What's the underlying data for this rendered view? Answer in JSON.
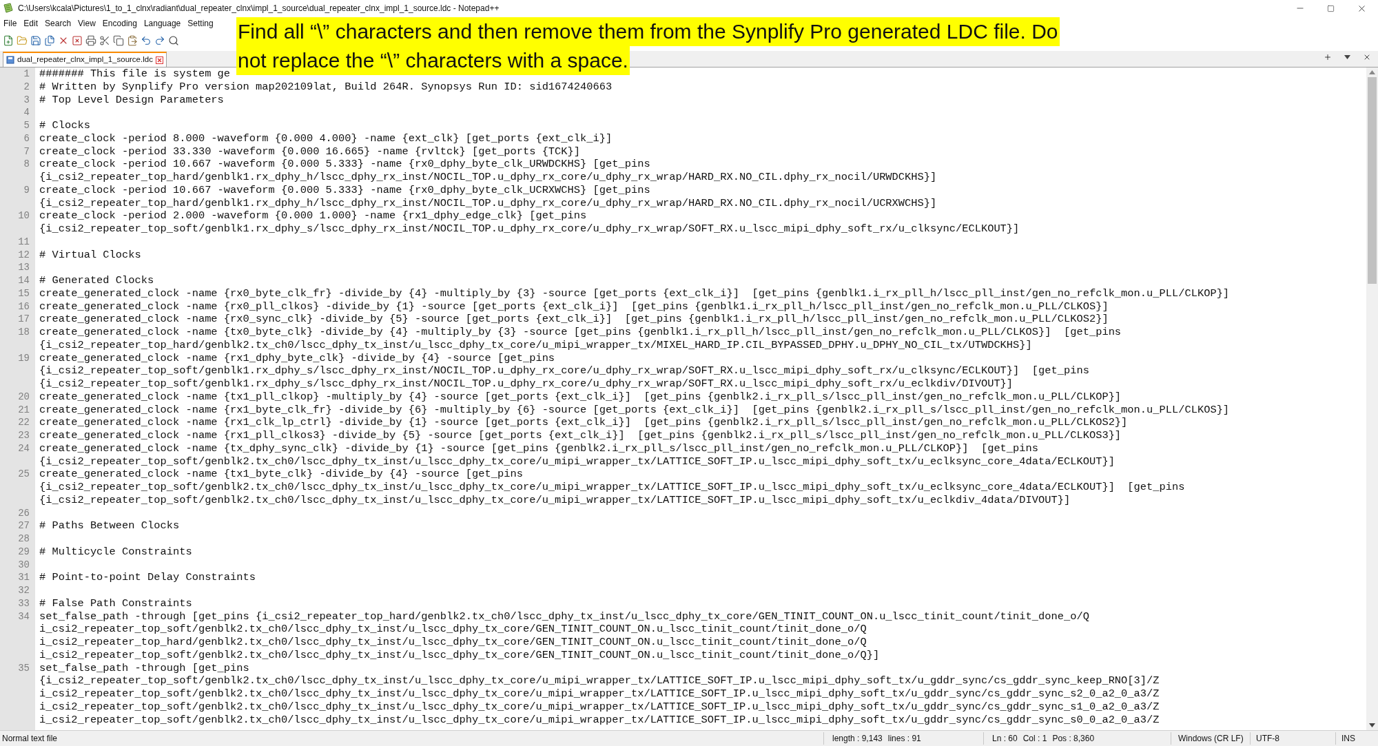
{
  "window": {
    "title": "C:\\Users\\kcala\\Pictures\\1_to_1_clnx\\radiant\\dual_repeater_clnx\\impl_1_source\\dual_repeater_clnx_impl_1_source.ldc - Notepad++"
  },
  "menu": [
    "File",
    "Edit",
    "Search",
    "View",
    "Encoding",
    "Language",
    "Setting"
  ],
  "tabs": [
    {
      "label": "dual_repeater_clnx_impl_1_source.ldc",
      "selected": true
    }
  ],
  "banner": {
    "lines": [
      "Find all “\\” characters and then remove them from the Synplify Pro generated LDC file. Do",
      "not replace the “\\” characters with a space."
    ]
  },
  "editor": {
    "lines": [
      {
        "number": "1",
        "segments": [
          "####### This file is system ge"
        ]
      },
      {
        "number": "2",
        "segments": [
          "# Written by Synplify Pro version map202109lat, Build 264R. Synopsys Run ID: sid1674240663"
        ]
      },
      {
        "number": "3",
        "segments": [
          "# Top Level Design Parameters"
        ]
      },
      {
        "number": "4"
      },
      {
        "number": "5",
        "segments": [
          "# Clocks"
        ]
      },
      {
        "number": "6",
        "segments": [
          "create_clock -period 8.000 -waveform {0.000 4.000} -name {ext_clk} [get_ports {ext_clk_i}]"
        ]
      },
      {
        "number": "7",
        "segments": [
          "create_clock -period 33.330 -waveform {0.000 16.665} -name {rvltck} [get_ports {TCK}]"
        ]
      },
      {
        "number": "8",
        "segments": [
          "create_clock -period 10.667 -waveform {0.000 5.333} -name {rx0_dphy_byte_clk_URWDCKHS} [get_pins",
          "{i_csi2_repeater_top_hard/genblk1.rx_dphy_h/lscc_dphy_rx_inst/NOCIL_TOP.u_dphy_rx_core/u_dphy_rx_wrap/HARD_RX.NO_CIL.dphy_rx_nocil/URWDCKHS}]"
        ]
      },
      {
        "number": "9",
        "segments": [
          "create_clock -period 10.667 -waveform {0.000 5.333} -name {rx0_dphy_byte_clk_UCRXWCHS} [get_pins",
          "{i_csi2_repeater_top_hard/genblk1.rx_dphy_h/lscc_dphy_rx_inst/NOCIL_TOP.u_dphy_rx_core/u_dphy_rx_wrap/HARD_RX.NO_CIL.dphy_rx_nocil/UCRXWCHS}]"
        ]
      },
      {
        "number": "10",
        "segments": [
          "create_clock -period 2.000 -waveform {0.000 1.000} -name {rx1_dphy_edge_clk} [get_pins",
          "{i_csi2_repeater_top_soft/genblk1.rx_dphy_s/lscc_dphy_rx_inst/NOCIL_TOP.u_dphy_rx_core/u_dphy_rx_wrap/SOFT_RX.u_lscc_mipi_dphy_soft_rx/u_clksync/ECLKOUT}]"
        ]
      },
      {
        "number": "11"
      },
      {
        "number": "12",
        "segments": [
          "# Virtual Clocks"
        ]
      },
      {
        "number": "13"
      },
      {
        "number": "14",
        "segments": [
          "# Generated Clocks"
        ]
      },
      {
        "number": "15",
        "segments": [
          "create_generated_clock -name {rx0_byte_clk_fr} -divide_by {4} -multiply_by {3} -source [get_ports {ext_clk_i}]  [get_pins {genblk1.i_rx_pll_h/lscc_pll_inst/gen_no_refclk_mon.u_PLL/CLKOP}]"
        ]
      },
      {
        "number": "16",
        "segments": [
          "create_generated_clock -name {rx0_pll_clkos} -divide_by {1} -source [get_ports {ext_clk_i}]  [get_pins {genblk1.i_rx_pll_h/lscc_pll_inst/gen_no_refclk_mon.u_PLL/CLKOS}]"
        ]
      },
      {
        "number": "17",
        "segments": [
          "create_generated_clock -name {rx0_sync_clk} -divide_by {5} -source [get_ports {ext_clk_i}]  [get_pins {genblk1.i_rx_pll_h/lscc_pll_inst/gen_no_refclk_mon.u_PLL/CLKOS2}]"
        ]
      },
      {
        "number": "18",
        "segments": [
          "create_generated_clock -name {tx0_byte_clk} -divide_by {4} -multiply_by {3} -source [get_pins {genblk1.i_rx_pll_h/lscc_pll_inst/gen_no_refclk_mon.u_PLL/CLKOS}]  [get_pins",
          "{i_csi2_repeater_top_hard/genblk2.tx_ch0/lscc_dphy_tx_inst/u_lscc_dphy_tx_core/u_mipi_wrapper_tx/MIXEL_HARD_IP.CIL_BYPASSED_DPHY.u_DPHY_NO_CIL_tx/UTWDCKHS}]"
        ]
      },
      {
        "number": "19",
        "segments": [
          "create_generated_clock -name {rx1_dphy_byte_clk} -divide_by {4} -source [get_pins",
          "{i_csi2_repeater_top_soft/genblk1.rx_dphy_s/lscc_dphy_rx_inst/NOCIL_TOP.u_dphy_rx_core/u_dphy_rx_wrap/SOFT_RX.u_lscc_mipi_dphy_soft_rx/u_clksync/ECLKOUT}]  [get_pins",
          "{i_csi2_repeater_top_soft/genblk1.rx_dphy_s/lscc_dphy_rx_inst/NOCIL_TOP.u_dphy_rx_core/u_dphy_rx_wrap/SOFT_RX.u_lscc_mipi_dphy_soft_rx/u_eclkdiv/DIVOUT}]"
        ]
      },
      {
        "number": "20",
        "segments": [
          "create_generated_clock -name {tx1_pll_clkop} -multiply_by {4} -source [get_ports {ext_clk_i}]  [get_pins {genblk2.i_rx_pll_s/lscc_pll_inst/gen_no_refclk_mon.u_PLL/CLKOP}]"
        ]
      },
      {
        "number": "21",
        "segments": [
          "create_generated_clock -name {rx1_byte_clk_fr} -divide_by {6} -multiply_by {6} -source [get_ports {ext_clk_i}]  [get_pins {genblk2.i_rx_pll_s/lscc_pll_inst/gen_no_refclk_mon.u_PLL/CLKOS}]"
        ]
      },
      {
        "number": "22",
        "segments": [
          "create_generated_clock -name {rx1_clk_lp_ctrl} -divide_by {1} -source [get_ports {ext_clk_i}]  [get_pins {genblk2.i_rx_pll_s/lscc_pll_inst/gen_no_refclk_mon.u_PLL/CLKOS2}]"
        ]
      },
      {
        "number": "23",
        "segments": [
          "create_generated_clock -name {rx1_pll_clkos3} -divide_by {5} -source [get_ports {ext_clk_i}]  [get_pins {genblk2.i_rx_pll_s/lscc_pll_inst/gen_no_refclk_mon.u_PLL/CLKOS3}]"
        ]
      },
      {
        "number": "24",
        "segments": [
          "create_generated_clock -name {tx_dphy_sync_clk} -divide_by {1} -source [get_pins {genblk2.i_rx_pll_s/lscc_pll_inst/gen_no_refclk_mon.u_PLL/CLKOP}]  [get_pins",
          "{i_csi2_repeater_top_soft/genblk2.tx_ch0/lscc_dphy_tx_inst/u_lscc_dphy_tx_core/u_mipi_wrapper_tx/LATTICE_SOFT_IP.u_lscc_mipi_dphy_soft_tx/u_eclksync_core_4data/ECLKOUT}]"
        ]
      },
      {
        "number": "25",
        "segments": [
          "create_generated_clock -name {tx1_byte_clk} -divide_by {4} -source [get_pins",
          "{i_csi2_repeater_top_soft/genblk2.tx_ch0/lscc_dphy_tx_inst/u_lscc_dphy_tx_core/u_mipi_wrapper_tx/LATTICE_SOFT_IP.u_lscc_mipi_dphy_soft_tx/u_eclksync_core_4data/ECLKOUT}]  [get_pins",
          "{i_csi2_repeater_top_soft/genblk2.tx_ch0/lscc_dphy_tx_inst/u_lscc_dphy_tx_core/u_mipi_wrapper_tx/LATTICE_SOFT_IP.u_lscc_mipi_dphy_soft_tx/u_eclkdiv_4data/DIVOUT}]"
        ]
      },
      {
        "number": "26"
      },
      {
        "number": "27",
        "segments": [
          "# Paths Between Clocks"
        ]
      },
      {
        "number": "28"
      },
      {
        "number": "29",
        "segments": [
          "# Multicycle Constraints"
        ]
      },
      {
        "number": "30"
      },
      {
        "number": "31",
        "segments": [
          "# Point-to-point Delay Constraints"
        ]
      },
      {
        "number": "32"
      },
      {
        "number": "33",
        "segments": [
          "# False Path Constraints"
        ]
      },
      {
        "number": "34",
        "segments": [
          "set_false_path -through [get_pins {i_csi2_repeater_top_hard/genblk2.tx_ch0/lscc_dphy_tx_inst/u_lscc_dphy_tx_core/GEN_TINIT_COUNT_ON.u_lscc_tinit_count/tinit_done_o/Q",
          "i_csi2_repeater_top_soft/genblk2.tx_ch0/lscc_dphy_tx_inst/u_lscc_dphy_tx_core/GEN_TINIT_COUNT_ON.u_lscc_tinit_count/tinit_done_o/Q",
          "i_csi2_repeater_top_hard/genblk2.tx_ch0/lscc_dphy_tx_inst/u_lscc_dphy_tx_core/GEN_TINIT_COUNT_ON.u_lscc_tinit_count/tinit_done_o/Q",
          "i_csi2_repeater_top_soft/genblk2.tx_ch0/lscc_dphy_tx_inst/u_lscc_dphy_tx_core/GEN_TINIT_COUNT_ON.u_lscc_tinit_count/tinit_done_o/Q}]"
        ]
      },
      {
        "number": "35",
        "segments": [
          "set_false_path -through [get_pins",
          "{i_csi2_repeater_top_soft/genblk2.tx_ch0/lscc_dphy_tx_inst/u_lscc_dphy_tx_core/u_mipi_wrapper_tx/LATTICE_SOFT_IP.u_lscc_mipi_dphy_soft_tx/u_gddr_sync/cs_gddr_sync_keep_RNO[3]/Z",
          "i_csi2_repeater_top_soft/genblk2.tx_ch0/lscc_dphy_tx_inst/u_lscc_dphy_tx_core/u_mipi_wrapper_tx/LATTICE_SOFT_IP.u_lscc_mipi_dphy_soft_tx/u_gddr_sync/cs_gddr_sync_s2_0_a2_0_a3/Z",
          "i_csi2_repeater_top_soft/genblk2.tx_ch0/lscc_dphy_tx_inst/u_lscc_dphy_tx_core/u_mipi_wrapper_tx/LATTICE_SOFT_IP.u_lscc_mipi_dphy_soft_tx/u_gddr_sync/cs_gddr_sync_s1_0_a2_0_a3/Z",
          "i_csi2_repeater_top_soft/genblk2.tx_ch0/lscc_dphy_tx_inst/u_lscc_dphy_tx_core/u_mipi_wrapper_tx/LATTICE_SOFT_IP.u_lscc_mipi_dphy_soft_tx/u_gddr_sync/cs_gddr_sync_s0_0_a2_0_a3/Z"
        ]
      }
    ]
  },
  "status_bar": {
    "file_type": "Normal text file",
    "length": "length : 9,143",
    "lines": "lines : 91",
    "ln": "Ln : 60",
    "col": "Col : 1",
    "pos": "Pos : 8,360",
    "eol": "Windows (CR LF)",
    "encoding": "UTF-8",
    "mode": "INS"
  }
}
